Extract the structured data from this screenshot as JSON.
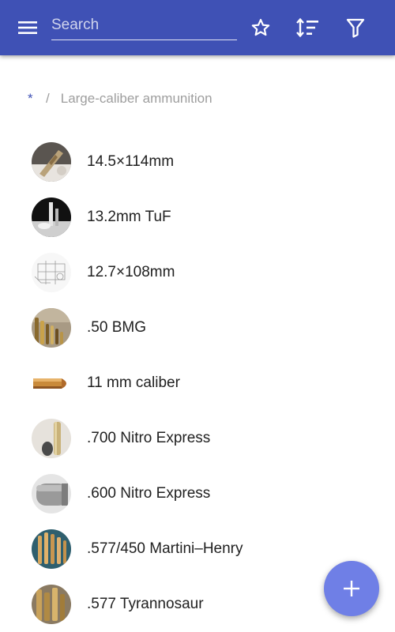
{
  "app_bar": {
    "search_placeholder": "Search",
    "icons": [
      "menu-icon",
      "star-outline-icon",
      "sort-icon",
      "filter-icon"
    ],
    "color": "#3f51b5"
  },
  "breadcrumb": {
    "root": "*",
    "separator": "/",
    "current": "Large-caliber ammunition"
  },
  "items": [
    {
      "label": "14.5×114mm"
    },
    {
      "label": "13.2mm TuF"
    },
    {
      "label": "12.7×108mm"
    },
    {
      "label": ".50 BMG"
    },
    {
      "label": "11 mm caliber"
    },
    {
      "label": ".700 Nitro Express"
    },
    {
      "label": ".600 Nitro Express"
    },
    {
      "label": ".577/450 Martini–Henry"
    },
    {
      "label": ".577 Tyrannosaur"
    }
  ],
  "fab": {
    "icon": "plus-icon",
    "color": "#6f7fe6"
  }
}
